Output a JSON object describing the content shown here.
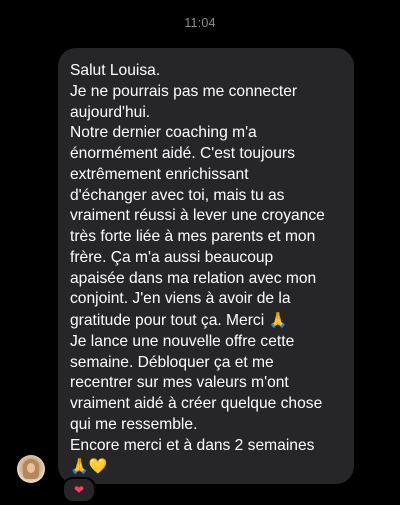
{
  "header": {
    "timestamp": "11:04"
  },
  "message": {
    "lines": [
      "Salut Louisa.",
      "Je ne pourrais pas me connecter",
      "aujourd'hui.",
      "Notre dernier coaching m'a",
      "énormément aidé. C'est toujours",
      "extrêmement enrichissant",
      "d'échanger avec toi, mais tu as",
      "vraiment réussi à lever une croyance",
      "très forte liée à mes parents et mon",
      "frère. Ça m'a aussi beaucoup",
      "apaisée dans ma relation avec mon",
      "conjoint. J'en viens à avoir de la",
      "gratitude pour tout ça. Merci",
      "Je lance une nouvelle offre cette",
      "semaine. Débloquer ça et me",
      "recentrer sur mes valeurs m'ont",
      "vraiment aidé à créer quelque chose",
      "qui me ressemble.",
      "Encore merci et à dans 2 semaines"
    ],
    "emoji_pray": "🙏",
    "emoji_yellow_heart": "💛",
    "emoji_pray_icon": "folded-hands-icon",
    "emoji_heart_icon": "yellow-heart-icon"
  },
  "reaction": {
    "emoji": "❤",
    "icon": "red-heart-icon",
    "color": "#ff3b5c"
  },
  "colors": {
    "background": "#000000",
    "bubble": "#262628",
    "timestamp": "#8e8e93",
    "text": "#ffffff"
  }
}
